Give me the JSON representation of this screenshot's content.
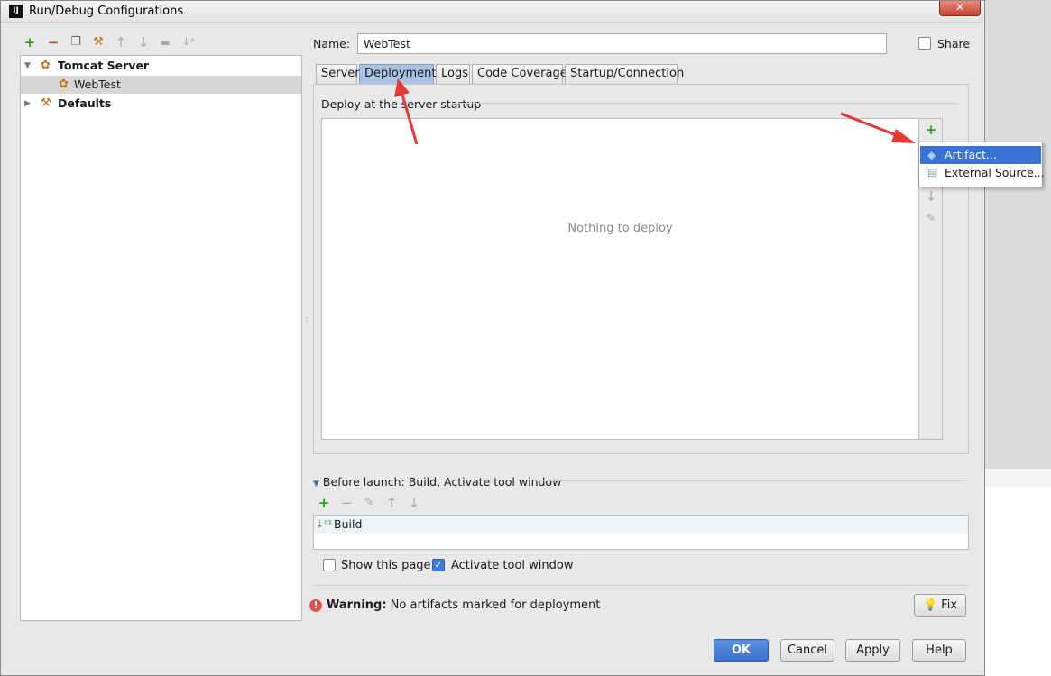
{
  "window": {
    "title": "Run/Debug Configurations",
    "app_icon": "IJ",
    "close_label": "✕"
  },
  "left_toolbar": {
    "icons": [
      "add-icon",
      "remove-icon",
      "copy-icon",
      "wrench-icon",
      "move-up-icon",
      "move-down-icon",
      "folder-icon",
      "sort-icon"
    ]
  },
  "tree": {
    "items": [
      {
        "label": "Tomcat Server",
        "icon": "tomcat-icon",
        "expanded": true
      },
      {
        "label": "WebTest",
        "icon": "tomcat-icon",
        "selected": true
      },
      {
        "label": "Defaults",
        "icon": "wrench-icon",
        "expanded": false
      }
    ]
  },
  "name_field": {
    "label": "Name:",
    "value": "WebTest"
  },
  "share": {
    "label": "Share",
    "checked": false
  },
  "tabs": [
    {
      "label": "Server"
    },
    {
      "label": "Deployment",
      "active": true
    },
    {
      "label": "Logs"
    },
    {
      "label": "Code Coverage"
    },
    {
      "label": "Startup/Connection"
    }
  ],
  "deployment": {
    "section_title": "Deploy at the server startup",
    "empty_text": "Nothing to deploy",
    "side_toolbar": [
      "add-icon",
      "move-down-icon",
      "edit-icon"
    ]
  },
  "popup_menu": {
    "items": [
      {
        "label": "Artifact...",
        "icon": "artifact-icon",
        "selected": true
      },
      {
        "label": "External Source...",
        "icon": "external-source-icon"
      }
    ]
  },
  "before_launch": {
    "title": "Before launch: Build, Activate tool window",
    "toolbar": [
      "add-icon",
      "remove-icon",
      "edit-icon",
      "move-up-icon",
      "move-down-icon"
    ],
    "items": [
      {
        "label": "Build",
        "icon": "build-icon"
      }
    ]
  },
  "options": {
    "show_this_page": {
      "label": "Show this page",
      "checked": false
    },
    "activate_tool_window": {
      "label": "Activate tool window",
      "checked": true
    }
  },
  "warning": {
    "prefix": "Warning:",
    "message": "No artifacts marked for deployment"
  },
  "buttons": {
    "fix": "Fix",
    "ok": "OK",
    "cancel": "Cancel",
    "apply": "Apply",
    "help": "Help"
  },
  "colors": {
    "accent": "#3d72cf",
    "tab_active": "#a8c3e4",
    "annotation_arrow": "#e53935",
    "warning": "#d9534f"
  }
}
